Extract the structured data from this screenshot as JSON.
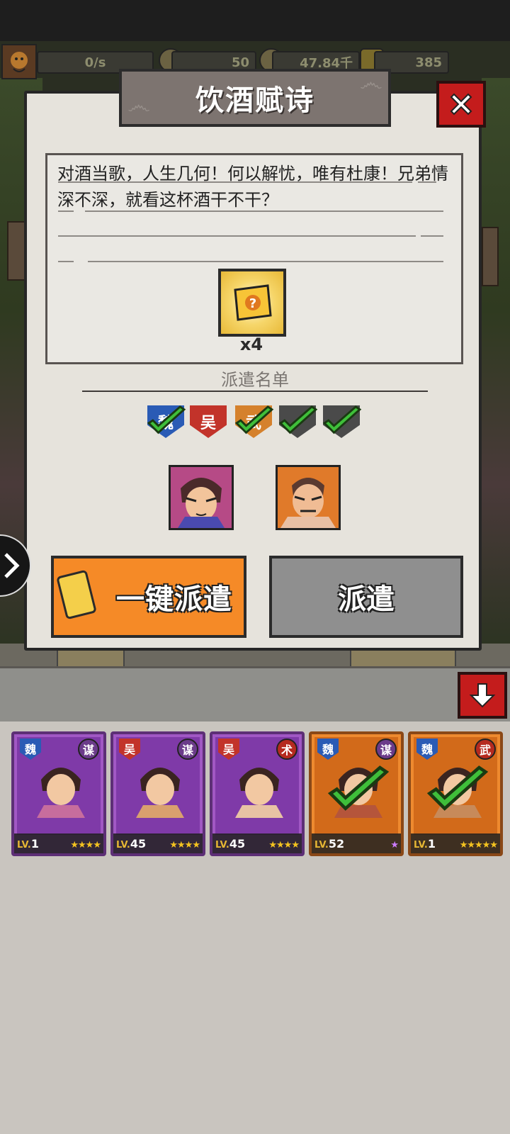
{
  "resource_bar": {
    "rate": "0/s",
    "coin": "50",
    "silver": "47.84千",
    "gold": "385"
  },
  "dialog": {
    "title": "饮酒赋诗",
    "poem": "对酒当歌，人生几何！何以解忧，唯有杜康！兄弟情深不深，就看这杯酒干不干？",
    "reward_count": "x4",
    "roster_label": "派遣名单",
    "requirements": [
      {
        "label": "魏",
        "color": "#2a5bb5",
        "met": true
      },
      {
        "label": "吴",
        "color": "#c2332a",
        "met": false
      },
      {
        "label": "武",
        "color": "#d5812c",
        "met": true
      },
      {
        "label": "",
        "color": "#4a4a4a",
        "met": true
      },
      {
        "label": "",
        "color": "#4a4a4a",
        "met": true
      }
    ],
    "auto_dispatch_label": "一键派遣",
    "dispatch_label": "派遣"
  },
  "heroes": [
    {
      "faction": "魏",
      "faction_color": "#2a5bb5",
      "role": "谋",
      "level": "1",
      "stars": "★★★★",
      "frame": "purple",
      "selected": false
    },
    {
      "faction": "吴",
      "faction_color": "#c2332a",
      "role": "谋",
      "level": "45",
      "stars": "★★★★",
      "frame": "purple",
      "selected": false
    },
    {
      "faction": "吴",
      "faction_color": "#c2332a",
      "role": "术",
      "level": "45",
      "stars": "★★★★",
      "frame": "purple",
      "selected": false
    },
    {
      "faction": "魏",
      "faction_color": "#2a5bb5",
      "role": "谋",
      "level": "52",
      "stars": "★",
      "frame": "orange",
      "selected": true
    },
    {
      "faction": "魏",
      "faction_color": "#2a5bb5",
      "role": "武",
      "level": "1",
      "stars": "★★★★★",
      "frame": "orange",
      "selected": true
    }
  ],
  "hero_level_prefix": "LV.",
  "icons": {
    "close": "close-icon",
    "collapse": "arrow-down-icon",
    "side": "chevron-right-icon",
    "reward": "mystery-scroll-icon",
    "auto": "dispatch-token-icon"
  }
}
